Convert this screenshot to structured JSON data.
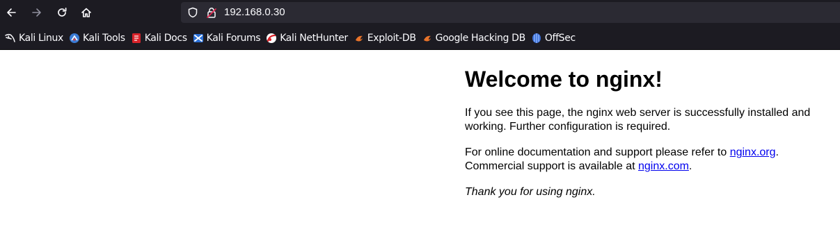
{
  "browser": {
    "url": "192.168.0.30",
    "bookmarks": [
      {
        "label": "Kali Linux",
        "icon": "kali-dragon-icon"
      },
      {
        "label": "Kali Tools",
        "icon": "kali-tools-icon"
      },
      {
        "label": "Kali Docs",
        "icon": "kali-docs-icon"
      },
      {
        "label": "Kali Forums",
        "icon": "kali-forums-icon"
      },
      {
        "label": "Kali NetHunter",
        "icon": "kali-nethunter-icon"
      },
      {
        "label": "Exploit-DB",
        "icon": "exploit-db-icon"
      },
      {
        "label": "Google Hacking DB",
        "icon": "google-hacking-db-icon"
      },
      {
        "label": "OffSec",
        "icon": "offsec-icon"
      }
    ],
    "colors": {
      "chrome_bg": "#1c1b22",
      "urlbar_bg": "#2b2a33",
      "text": "#fbfbfe",
      "lock_warning": "#e22850"
    }
  },
  "page": {
    "title": "Welcome to nginx!",
    "p1": "If you see this page, the nginx web server is successfully installed and working. Further configuration is required.",
    "p2_prefix": "For online documentation and support please refer to ",
    "p2_link1": "nginx.org",
    "p2_middle": ".\nCommercial support is available at ",
    "p2_link2": "nginx.com",
    "p2_suffix": ".",
    "p3": "Thank you for using nginx.",
    "link_color": "#0000ee"
  }
}
